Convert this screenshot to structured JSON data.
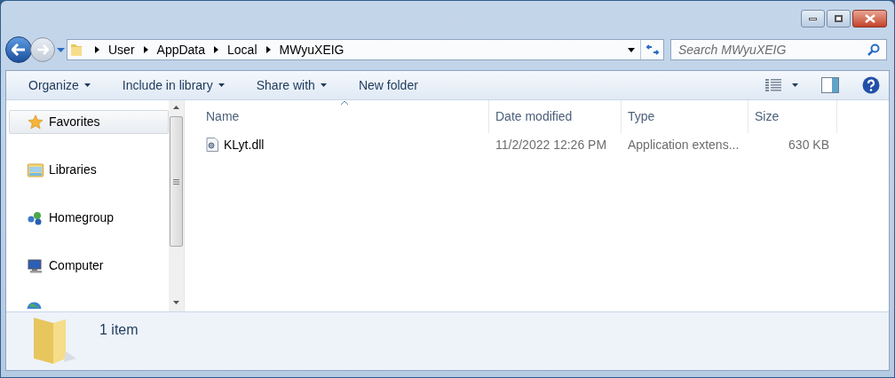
{
  "breadcrumb": [
    "User",
    "AppData",
    "Local",
    "MWyuXEIG"
  ],
  "search": {
    "placeholder": "Search MWyuXEIG"
  },
  "toolbar": [
    {
      "label": "Organize",
      "dropdown": true
    },
    {
      "label": "Include in library",
      "dropdown": true
    },
    {
      "label": "Share with",
      "dropdown": true
    },
    {
      "label": "New folder",
      "dropdown": false
    }
  ],
  "nav_items": [
    {
      "label": "Favorites",
      "kind": "star",
      "selected": true
    },
    {
      "label": "Libraries",
      "kind": "library",
      "selected": false
    },
    {
      "label": "Homegroup",
      "kind": "homegroup",
      "selected": false
    },
    {
      "label": "Computer",
      "kind": "computer",
      "selected": false
    }
  ],
  "columns": [
    {
      "label": "Name",
      "sorted": true
    },
    {
      "label": "Date modified",
      "sorted": false
    },
    {
      "label": "Type",
      "sorted": false
    },
    {
      "label": "Size",
      "sorted": false
    }
  ],
  "rows": [
    {
      "name": "KLyt.dll",
      "date": "11/2/2022 12:26 PM",
      "type": "Application extens...",
      "size": "630 KB"
    }
  ],
  "status_bar": {
    "text": "1 item"
  }
}
